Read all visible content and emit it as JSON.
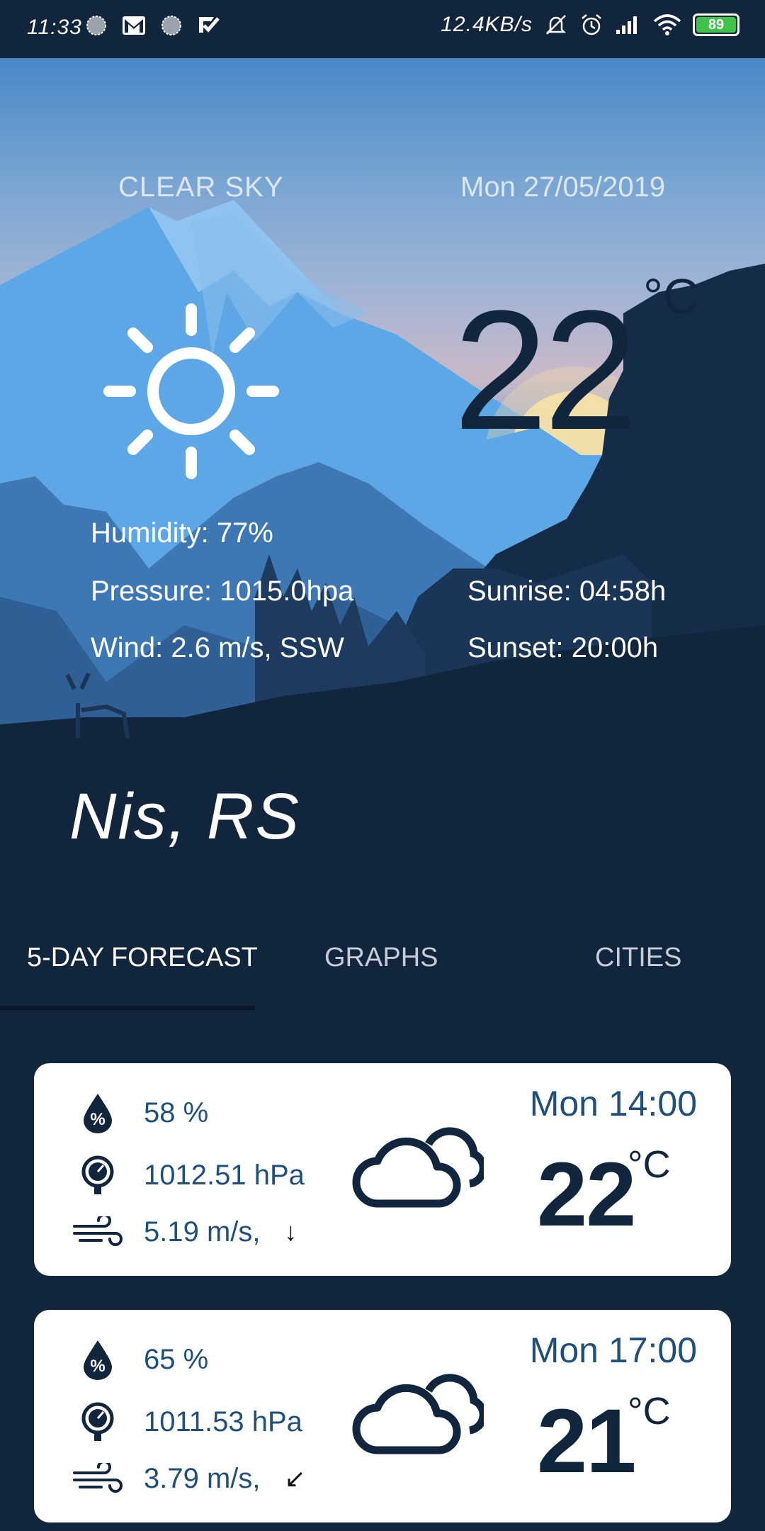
{
  "status_bar": {
    "time": "11:33",
    "network_speed": "12.4KB/s",
    "battery": "89",
    "left_icons": [
      "loading-icon",
      "gmail-icon",
      "loading-icon",
      "check-icon"
    ],
    "right_icons": [
      "mute-icon",
      "alarm-icon",
      "signal-icon",
      "wifi-icon"
    ]
  },
  "current": {
    "condition": "CLEAR SKY",
    "date": "Mon 27/05/2019",
    "temperature": "22",
    "unit": "°C",
    "icon": "sun-icon",
    "humidity": "Humidity: 77%",
    "pressure": "Pressure: 1015.0hpa",
    "wind": "Wind: 2.6 m/s, SSW",
    "sunrise": "Sunrise: 04:58h",
    "sunset": "Sunset: 20:00h"
  },
  "city": "Nis, RS",
  "tabs": [
    {
      "label": "5-DAY FORECAST",
      "active": true
    },
    {
      "label": "GRAPHS",
      "active": false
    },
    {
      "label": "CITIES",
      "active": false
    }
  ],
  "forecast": [
    {
      "humidity": "58 %",
      "pressure": "1012.51 hPa",
      "wind": "5.19 m/s,",
      "wind_arrow": "↓",
      "time": "Mon 14:00",
      "temp": "22",
      "unit": "°C",
      "icon": "cloud-icon"
    },
    {
      "humidity": "65 %",
      "pressure": "1011.53 hPa",
      "wind": "3.79 m/s,",
      "wind_arrow": "↙",
      "time": "Mon 17:00",
      "temp": "21",
      "unit": "°C",
      "icon": "cloud-icon"
    }
  ],
  "colors": {
    "background": "#11253d",
    "card": "#ffffff",
    "accent_text": "#1f4f7a",
    "battery": "#3ec24a"
  }
}
